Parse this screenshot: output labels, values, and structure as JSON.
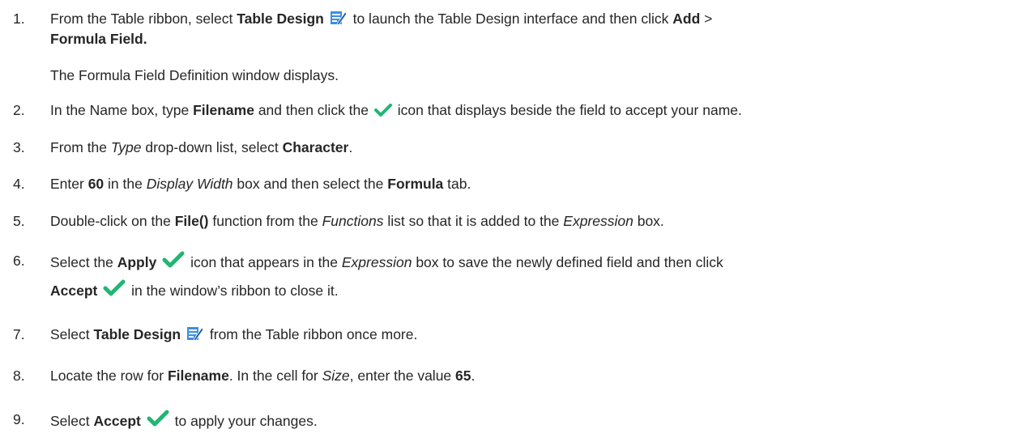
{
  "steps": [
    {
      "num": "1.",
      "line1": {
        "t1": "From the Table ribbon, select ",
        "b1": "Table Design",
        "t2": " to launch the Table Design interface and then click ",
        "b2": "Add",
        "t3": " >"
      },
      "line2": {
        "b1": "Formula Field."
      },
      "note": "The Formula Field Definition window displays."
    },
    {
      "num": "2.",
      "t1": "In the Name box, type ",
      "b1": "Filename",
      "t2": " and then click the ",
      "t3": " icon that displays beside the field to accept your name."
    },
    {
      "num": "3.",
      "t1": "From the ",
      "i1": "Type",
      "t2": " drop-down list, select ",
      "b1": "Character",
      "t3": "."
    },
    {
      "num": "4.",
      "t1": "Enter ",
      "b1": "60",
      "t2": " in the ",
      "i1": "Display Width",
      "t3": " box and then select the ",
      "b2": "Formula",
      "t4": " tab."
    },
    {
      "num": "5.",
      "t1": "Double-click on the ",
      "b1": "File()",
      "t2": " function from the ",
      "i1": "Functions",
      "t3": " list so that it is added to the ",
      "i2": "Expression",
      "t4": " box."
    },
    {
      "num": "6.",
      "line1": {
        "t1": "Select the ",
        "b1": "Apply",
        "t2": " icon that appears in the ",
        "i1": "Expression",
        "t3": " box to save the newly defined field and then click"
      },
      "line2": {
        "b1": "Accept",
        "t1": " in the window’s ribbon to close it."
      }
    },
    {
      "num": "7.",
      "t1": "Select ",
      "b1": "Table Design",
      "t2": " from the Table ribbon once more."
    },
    {
      "num": "8.",
      "t1": "Locate the row for ",
      "b1": "Filename",
      "t2": ". In the cell for ",
      "i1": "Size",
      "t3": ", enter the value ",
      "b2": "65",
      "t4": "."
    },
    {
      "num": "9.",
      "t1": "Select ",
      "b1": "Accept",
      "t2": " to apply your changes."
    }
  ],
  "icons": {
    "table_design": "table-design-icon",
    "accept": "checkmark-icon",
    "accent_blue": "#2e86de",
    "accent_green": "#22b573"
  }
}
